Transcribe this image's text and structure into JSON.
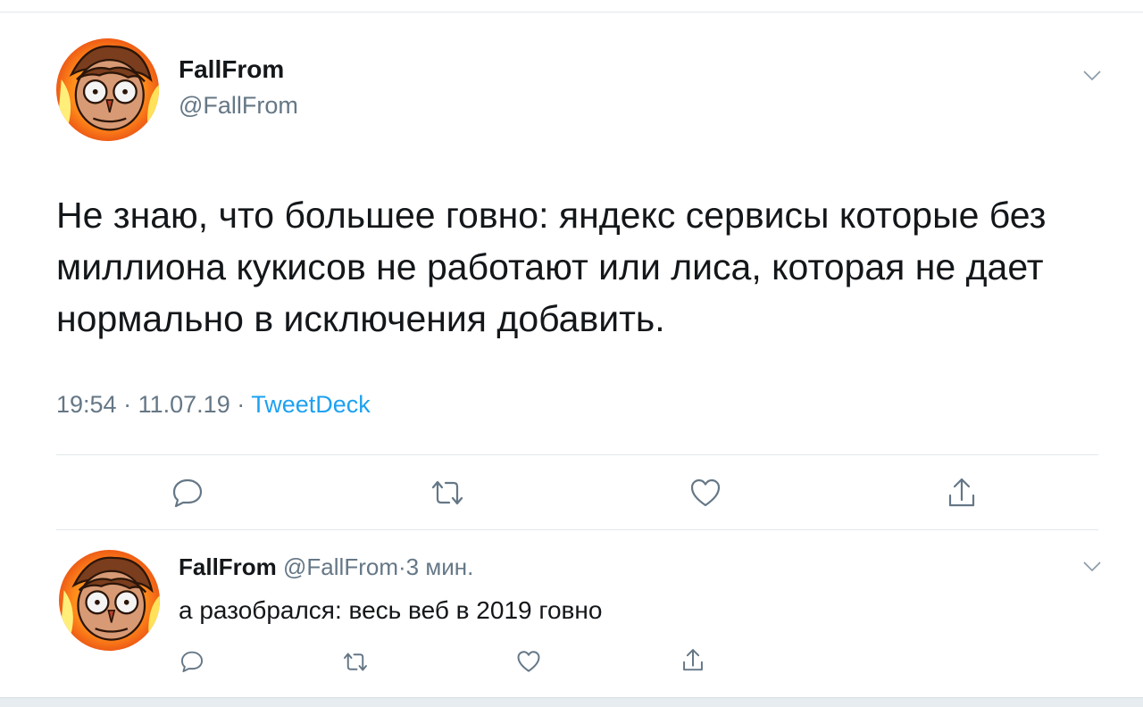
{
  "tweet": {
    "author_name": "FallFrom",
    "author_handle": "@FallFrom",
    "text": "Не знаю, что большее говно: яндекс сервисы которые без миллиона кукисов не работают или лиса, которая не дает нормально в исключения добавить.",
    "time": "19:54",
    "separator": "·",
    "date": "11.07.19",
    "source": "TweetDeck",
    "menu_icon": "chevron-down-icon",
    "actions": [
      {
        "name": "reply",
        "icon": "reply-icon"
      },
      {
        "name": "retweet",
        "icon": "retweet-icon"
      },
      {
        "name": "like",
        "icon": "heart-icon"
      },
      {
        "name": "share",
        "icon": "share-icon"
      }
    ]
  },
  "reply": {
    "author_name": "FallFrom",
    "author_handle": "@FallFrom",
    "separator": "·",
    "time_ago": "3 мин.",
    "text": "а разобрался: весь веб в 2019 говно",
    "menu_icon": "chevron-down-icon"
  },
  "colors": {
    "text": "#14171a",
    "secondary": "#657786",
    "link": "#1da1f2",
    "divider": "#e1e8ed"
  }
}
